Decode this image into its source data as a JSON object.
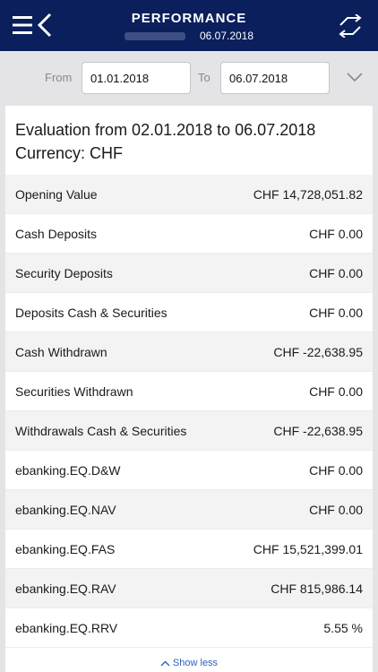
{
  "header": {
    "title": "PERFORMANCE",
    "date": "06.07.2018",
    "icons": {
      "menu": "hamburger-back-icon",
      "swap": "swap-arrows-icon"
    }
  },
  "filter": {
    "from_label": "From",
    "from_value": "01.01.2018",
    "to_label": "To",
    "to_value": "06.07.2018",
    "expand_icon": "chevron-down-icon"
  },
  "evaluation": {
    "title_line1": "Evaluation from 02.01.2018 to 06.07.2018",
    "title_line2": "Currency: CHF"
  },
  "rows": [
    {
      "label": "Opening Value",
      "value": "CHF 14,728,051.82"
    },
    {
      "label": "Cash Deposits",
      "value": "CHF 0.00"
    },
    {
      "label": "Security Deposits",
      "value": "CHF 0.00"
    },
    {
      "label": "Deposits Cash & Securities",
      "value": "CHF 0.00"
    },
    {
      "label": "Cash Withdrawn",
      "value": "CHF -22,638.95"
    },
    {
      "label": "Securities Withdrawn",
      "value": "CHF 0.00"
    },
    {
      "label": "Withdrawals Cash & Securities",
      "value": "CHF -22,638.95"
    },
    {
      "label": "ebanking.EQ.D&W",
      "value": "CHF 0.00"
    },
    {
      "label": "ebanking.EQ.NAV",
      "value": "CHF 0.00"
    },
    {
      "label": "ebanking.EQ.FAS",
      "value": "CHF 15,521,399.01"
    },
    {
      "label": "ebanking.EQ.RAV",
      "value": "CHF 815,986.14"
    },
    {
      "label": "ebanking.EQ.RRV",
      "value": "5.55 %"
    }
  ],
  "footer": {
    "show_less": "Show less"
  },
  "colors": {
    "header_bg": "#0a1f5c",
    "link": "#2a62b8",
    "row_shade": "#f3f3f3"
  }
}
